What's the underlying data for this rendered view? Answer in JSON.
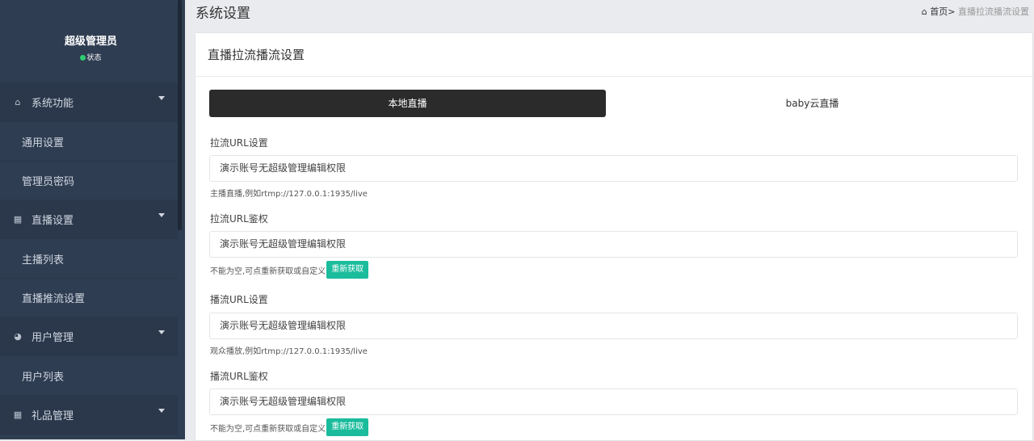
{
  "sidebar": {
    "user_name": "超级管理员",
    "status": "状态",
    "items": [
      {
        "label": "系统功能",
        "icon": "home-icon",
        "type": "group"
      },
      {
        "label": "通用设置",
        "type": "sub"
      },
      {
        "label": "管理员密码",
        "type": "sub"
      },
      {
        "label": "直播设置",
        "icon": "table-icon",
        "type": "group"
      },
      {
        "label": "主播列表",
        "type": "sub"
      },
      {
        "label": "直播推流设置",
        "type": "sub"
      },
      {
        "label": "用户管理",
        "icon": "pie-chart-icon",
        "type": "group"
      },
      {
        "label": "用户列表",
        "type": "sub"
      },
      {
        "label": "礼品管理",
        "icon": "table-icon",
        "type": "group"
      }
    ]
  },
  "header": {
    "title": "系统设置",
    "breadcrumb_home": "首页",
    "breadcrumb_sep": ">",
    "breadcrumb_current": "直播拉流播流设置"
  },
  "panel": {
    "title": "直播拉流播流设置",
    "tabs": [
      {
        "label": "本地直播",
        "active": true
      },
      {
        "label": "baby云直播",
        "active": false
      }
    ],
    "fields": [
      {
        "label": "拉流URL设置",
        "value": "演示账号无超级管理编辑权限",
        "help": "主播直播,例如rtmp://127.0.0.1:1935/live"
      },
      {
        "label": "拉流URL鉴权",
        "value": "演示账号无超级管理编辑权限",
        "help": "不能为空,可点重新获取或自定义",
        "button": "重新获取"
      },
      {
        "label": "播流URL设置",
        "value": "演示账号无超级管理编辑权限",
        "help": "观众播放,例如rtmp://127.0.0.1:1935/live"
      },
      {
        "label": "播流URL鉴权",
        "value": "演示账号无超级管理编辑权限",
        "help": "不能为空,可点重新获取或自定义",
        "button": "重新获取"
      }
    ]
  },
  "colors": {
    "sidebar_bg": "#2f3d52",
    "active_tab": "#2b2b2b",
    "button": "#1abc9c",
    "status_dot": "#2ecc71"
  }
}
